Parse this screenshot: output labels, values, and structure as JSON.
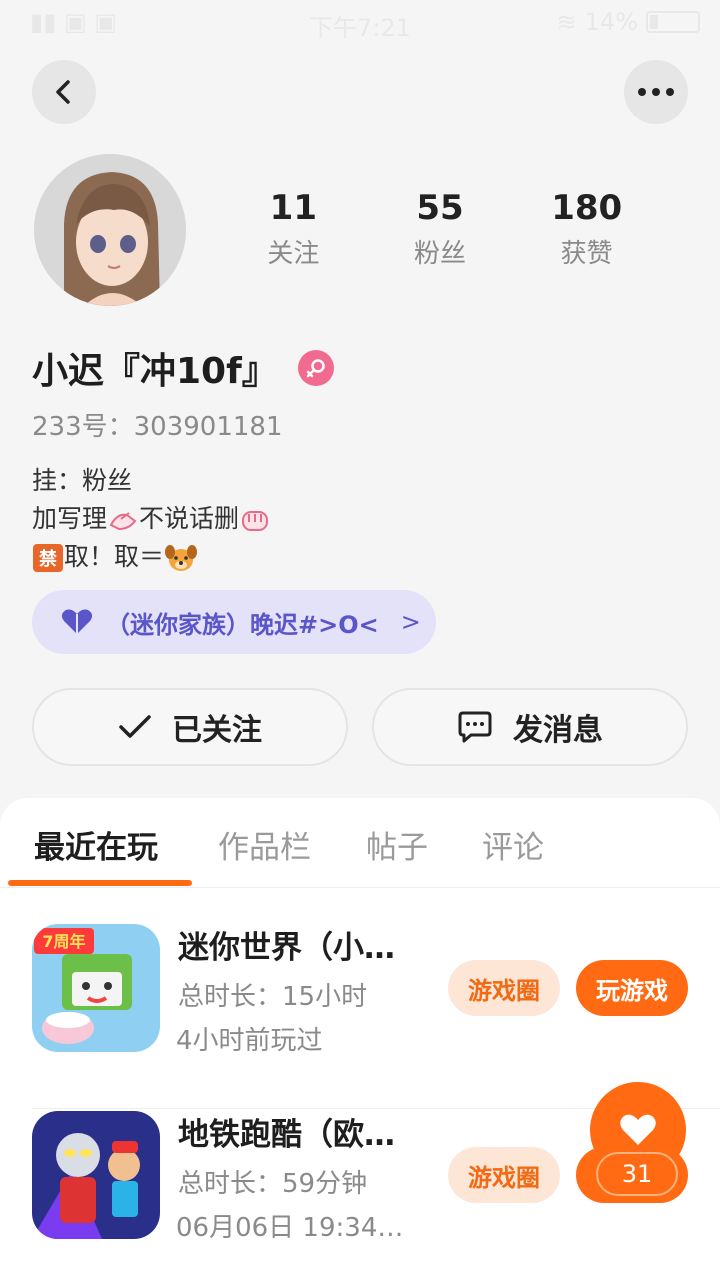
{
  "status_bar": {
    "time": "下午7:21",
    "battery": "14%"
  },
  "profile": {
    "stats": [
      {
        "value": "11",
        "label": "关注"
      },
      {
        "value": "55",
        "label": "粉丝"
      },
      {
        "value": "180",
        "label": "获赞"
      }
    ],
    "nickname": "小迟『冲10f』",
    "uid": "233号：303901181",
    "bio": {
      "line1": "挂：粉丝",
      "line2_prefix": "加写理",
      "line2_mid": "不说话删",
      "line3_prefix": "取！取＝"
    },
    "family_label": "（迷你家族）晚迟#>O<",
    "family_arrow": ">"
  },
  "actions": {
    "follow_label": "已关注",
    "message_label": "发消息"
  },
  "tabs": [
    "最近在玩",
    "作品栏",
    "帖子",
    "评论"
  ],
  "games": [
    {
      "title": "迷你世界（小…",
      "duration": "总时长：15小时",
      "last_played": "4小时前玩过",
      "circle_label": "游戏圈",
      "play_label": "玩游戏",
      "icon_badge": "7周年"
    },
    {
      "title": "地铁跑酷（欧…",
      "duration": "总时长：59分钟",
      "last_played": "06月06日 19:34…",
      "circle_label": "游戏圈"
    }
  ],
  "like_button": {
    "count": "31"
  },
  "colors": {
    "accent": "#ff6a13",
    "family_bg": "#e3e2f8",
    "family_text": "#5a55c9",
    "gender": "#f06b8f"
  }
}
